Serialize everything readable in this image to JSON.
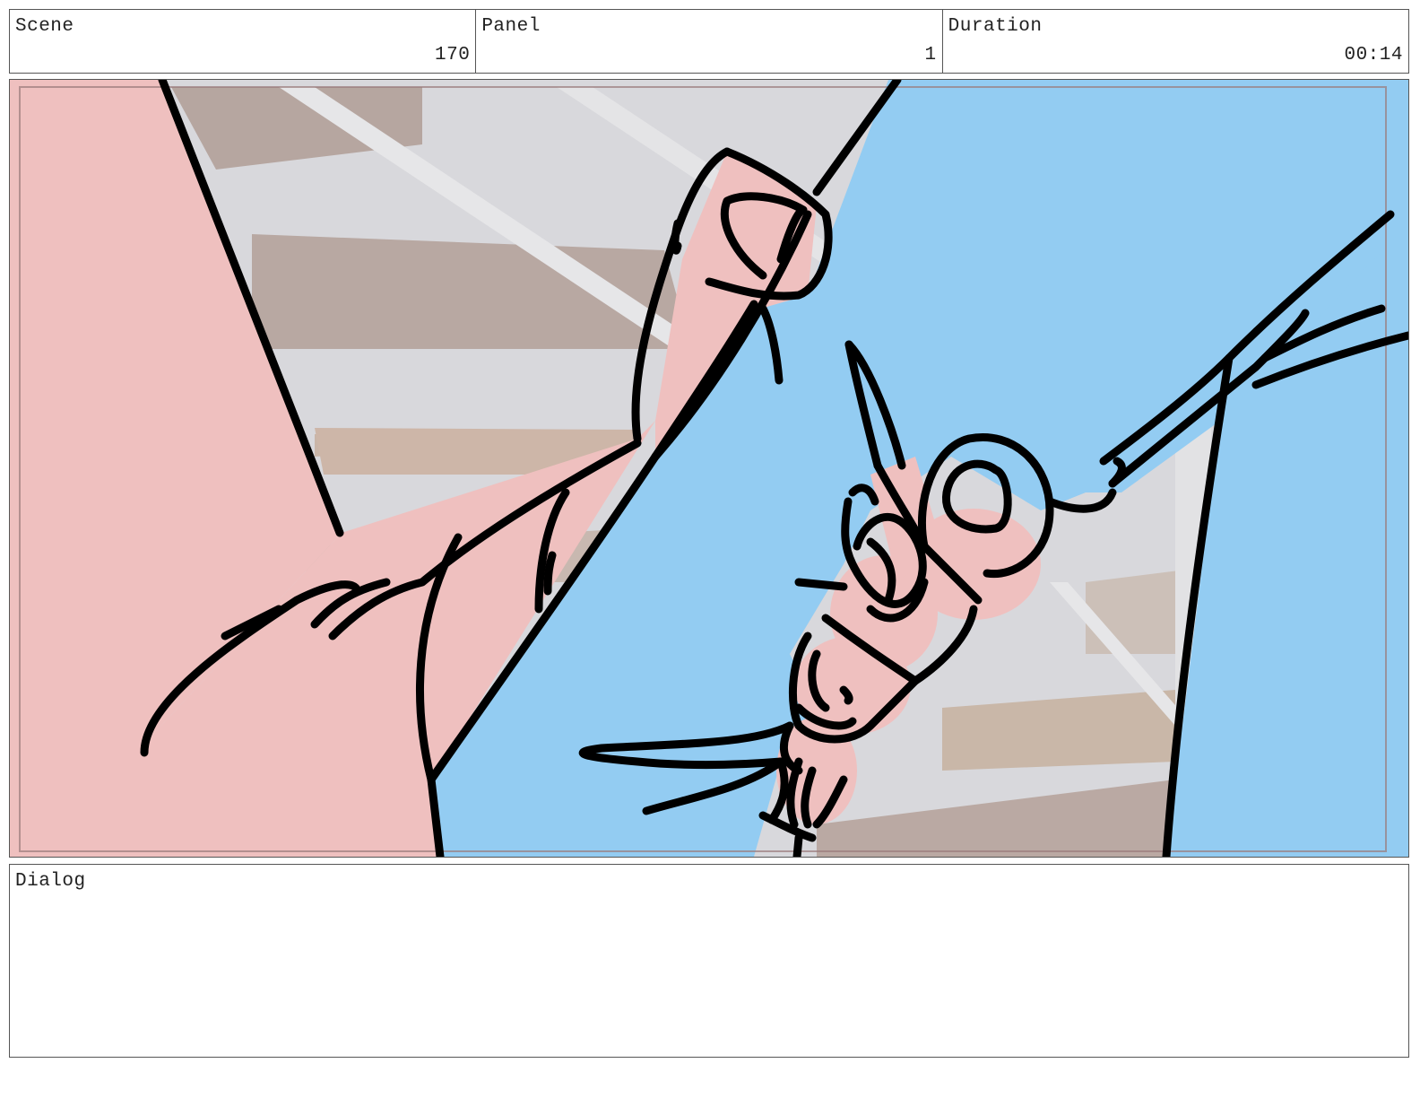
{
  "header": {
    "scene": {
      "label": "Scene",
      "value": "170"
    },
    "panel": {
      "label": "Panel",
      "value": "1"
    },
    "duration": {
      "label": "Duration",
      "value": "00:14"
    }
  },
  "dialog": {
    "label": "Dialog",
    "text": ""
  },
  "colors": {
    "skin": "#efc0bf",
    "sky": "#93ccf2",
    "background_gray": "#d4d4d8",
    "background_brown": "#b6a6a0",
    "ink": "#000000",
    "border": "#555555"
  }
}
